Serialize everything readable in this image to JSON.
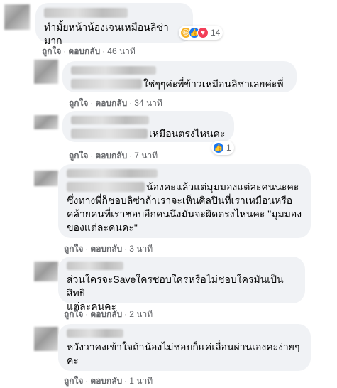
{
  "comments": [
    {
      "text": "ทำมั้ยหน้าน้องเจนเหมือนลิซ่ามาก",
      "like_label": "ถูกใจ",
      "reply_label": "ตอบกลับ",
      "time": "46 นาที",
      "reactions": {
        "icons": [
          "haha-icon",
          "like-icon",
          "love-icon"
        ],
        "count": "14"
      }
    },
    {
      "text": "ใช่ๆๆค่ะพี่ข้าวเหมือนลิซ่าเลยค่ะพี่",
      "like_label": "ถูกใจ",
      "reply_label": "ตอบกลับ",
      "time": "34 นาที"
    },
    {
      "text": "เหมือนตรงไหนคะ",
      "like_label": "ถูกใจ",
      "reply_label": "ตอบกลับ",
      "time": "7 นาที",
      "reactions": {
        "icons": [
          "like-icon"
        ],
        "count": "1"
      }
    },
    {
      "text_line1": "น้องคะแล้วแต่มุมมองแต่ละคนนะคะ",
      "text_line2": "ซึ่งทางพี่ก็ชอบลิซ่าถ้าเราจะเห็นศิลปินที่เราเหมือนหรือ",
      "text_line3": "คล้ายคนที่เราชอบอีกคนนึงมันจะผิดตรงไหนคะ \"มุมมอง",
      "text_line4": "ของแต่ละคนคะ\"",
      "like_label": "ถูกใจ",
      "reply_label": "ตอบกลับ",
      "time": "3 นาที"
    },
    {
      "text_line1": "ส่วนใครจะSaveใครชอบใครหรือไม่ชอบใครมันเป็นสิทธิ",
      "text_line2": "แต่ละคนคะ",
      "like_label": "ถูกใจ",
      "reply_label": "ตอบกลับ",
      "time": "2 นาที"
    },
    {
      "text_line1": "หวังวาคงเข้าใจถ้าน้องไม่ชอบก็แค่เลื่อนผ่านเองคะง่ายๆ",
      "text_line2": "คะ",
      "like_label": "ถูกใจ",
      "reply_label": "ตอบกลับ",
      "time": "1 นาที"
    }
  ]
}
